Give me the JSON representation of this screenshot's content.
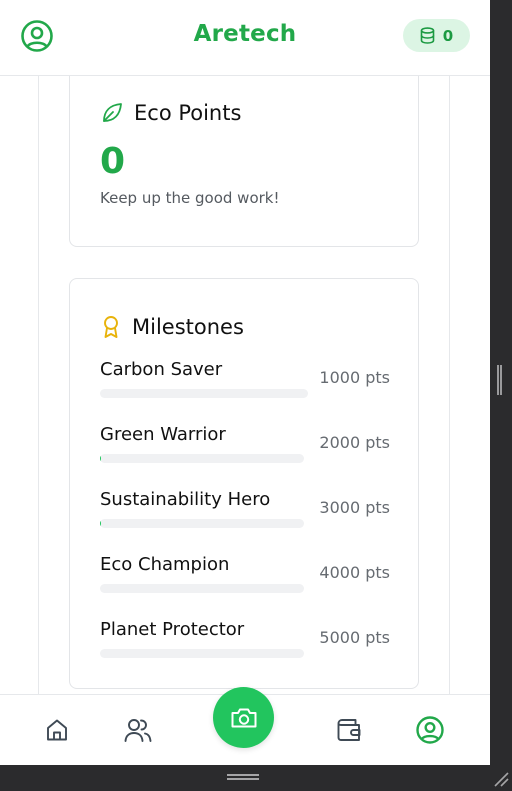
{
  "header": {
    "title": "Aretech",
    "coins": "0",
    "profile_icon": "user-circle-icon",
    "coin_icon": "coin-stack-icon"
  },
  "eco_points": {
    "title": "Eco Points",
    "icon": "leaf-icon",
    "value": "0",
    "message": "Keep up the good work!"
  },
  "milestones": {
    "title": "Milestones",
    "icon": "award-ribbon-icon",
    "items": [
      {
        "name": "Carbon Saver",
        "points": "1000 pts",
        "progress": 0
      },
      {
        "name": "Green Warrior",
        "points": "2000 pts",
        "progress": 0.003
      },
      {
        "name": "Sustainability Hero",
        "points": "3000 pts",
        "progress": 0.003
      },
      {
        "name": "Eco Champion",
        "points": "4000 pts",
        "progress": 0
      },
      {
        "name": "Planet Protector",
        "points": "5000 pts",
        "progress": 0
      }
    ]
  },
  "bottom_nav": {
    "items": [
      "home-icon",
      "community-users-icon",
      "camera-icon",
      "wallet-icon",
      "profile-icon"
    ],
    "active": "profile-icon"
  },
  "colors": {
    "brand_green": "#22a84a",
    "accent_green": "#22c55e",
    "badge_bg": "#dcf5e4",
    "award_gold": "#e8b30b"
  }
}
